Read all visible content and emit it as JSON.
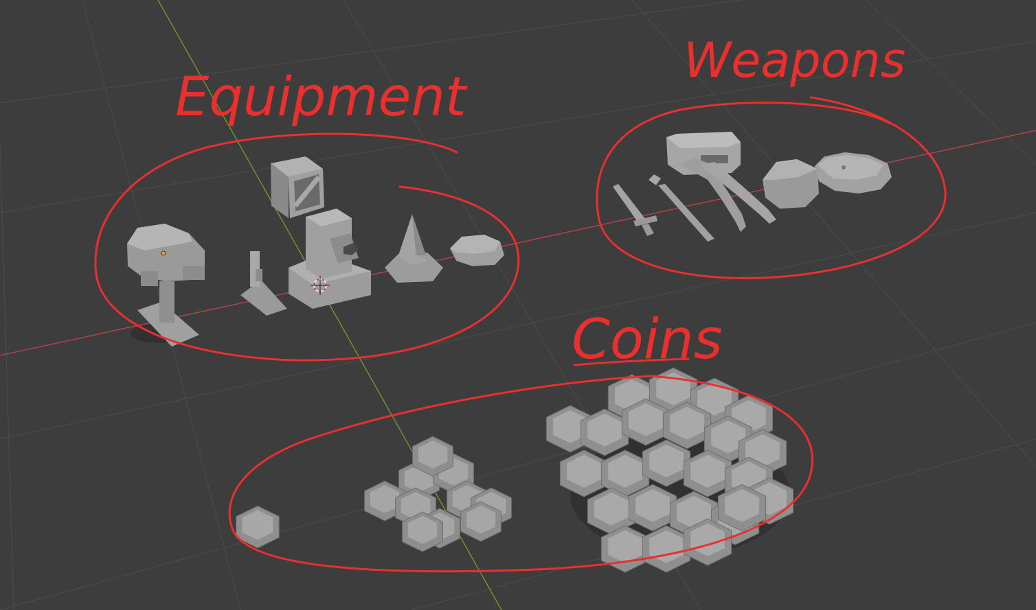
{
  "viewport": {
    "type": "3d-viewport",
    "background_color": "#3d3d3d",
    "grid_color": "#4a4a4a",
    "x_axis_color": "#b8434b",
    "y_axis_color": "#6f9a2c",
    "object_color": "#a6a6a6",
    "origin_marker_color": "#f0a030"
  },
  "annotations": {
    "ink_color": "#e8302f",
    "groups": [
      {
        "id": "equipment",
        "label": "Equipment"
      },
      {
        "id": "weapons",
        "label": "Weapons"
      },
      {
        "id": "coins",
        "label": "Coins"
      }
    ]
  },
  "objects": {
    "equipment": [
      "dome-helmet",
      "pedestal",
      "lever-switch",
      "crate",
      "cannon-tower",
      "spike-cone",
      "octagon-plate"
    ],
    "weapons": [
      "sword",
      "short-sword",
      "scythe",
      "bone-club",
      "hammer-head",
      "boulder",
      "round-shield"
    ],
    "coins": [
      "single-coin",
      "small-coin-pile",
      "large-coin-pile"
    ]
  }
}
